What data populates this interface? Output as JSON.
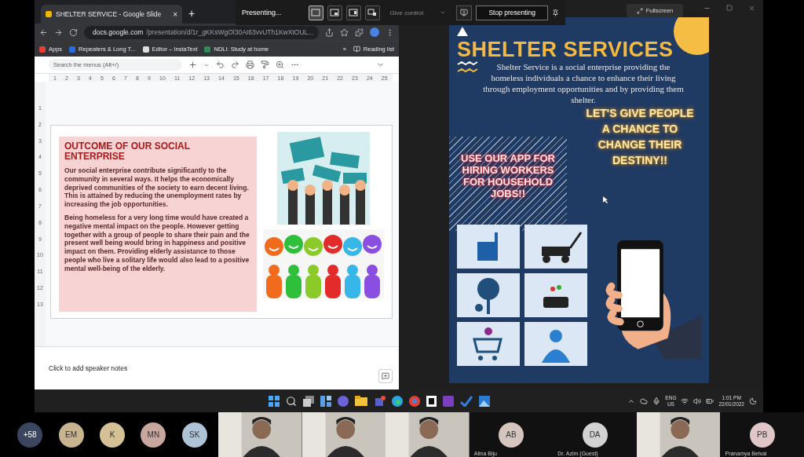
{
  "presenting_bar": {
    "status": "Presenting...",
    "layouts": [
      {
        "kind": "content",
        "selected": true
      },
      {
        "kind": "standout",
        "selected": false
      },
      {
        "kind": "side",
        "selected": false
      },
      {
        "kind": "reporter",
        "selected": false
      }
    ],
    "give_control": {
      "label": "Give control",
      "disabled": true
    },
    "stop_button": "Stop presenting"
  },
  "fullscreen_button": "Fullscreen",
  "browser": {
    "tab": {
      "title": "SHELTER SERVICE - Google Slide",
      "close": "×"
    },
    "new_tab": "+",
    "url": {
      "host": "docs.google.com",
      "path": "/presentation/d/1r_gKKsWgOl30AI63vvUTh1KwXtOUL..."
    },
    "bookmarks": [
      "Apps",
      "Repeaters & Long T...",
      "Editor – InstaText",
      "NDLI: Study at home"
    ],
    "more": "»",
    "reading_list": "Reading list"
  },
  "slides_app": {
    "search": {
      "placeholder": "Search the menus (Alt+/)"
    },
    "ruler": [
      "1",
      "2",
      "3",
      "4",
      "5",
      "6",
      "7",
      "8",
      "9",
      "10",
      "11",
      "12",
      "13",
      "14",
      "15",
      "16",
      "17",
      "18",
      "19",
      "20",
      "21",
      "22",
      "23",
      "24",
      "25"
    ],
    "vertical_ruler": [
      "1",
      "2",
      "3",
      "4",
      "5",
      "6",
      "7",
      "8",
      "9",
      "10",
      "11",
      "12",
      "13"
    ],
    "slide": {
      "title": "OUTCOME OF OUR SOCIAL ENTERPRISE",
      "paragraphs": [
        "Our social enterprise contribute significantly to the community in several ways. It helps the economically deprived communities of the society to earn decent living. This is attained by reducing the unemployment rates by increasing the job opportunities.",
        "Being homeless for a very long time would have created a negative mental impact on the people. However getting together with a group of people to share their pain and the present well being would bring in happiness and positive impact on them. Providing elderly assistance to those  people who live a solitary life would also lead to a positive mental well-being of the elderly."
      ]
    },
    "speaker_notes": {
      "placeholder": "Click to add speaker notes"
    }
  },
  "poster": {
    "title": "SHELTER SERVICES",
    "intro": "Shelter Service is a social enterprise providing the homeless individuals a chance to enhance their living through employment opportunities and by providing them shelter.",
    "slogan": "LET'S GIVE PEOPLE A CHANCE TO CHANGE THEIR DESTINY!!",
    "app_call": "USE OUR APP FOR HIRING WORKERS FOR HOUSEHOLD JOBS!!"
  },
  "taskbar": {
    "language": "ENG",
    "region": "US",
    "time": "1:01 PM",
    "date": "22/01/2022"
  },
  "participants": [
    {
      "kind": "bubble",
      "initials": "+58",
      "color": "#3a4560"
    },
    {
      "kind": "bubble",
      "initials": "EM",
      "color": "#c8b48e"
    },
    {
      "kind": "bubble",
      "initials": "K",
      "color": "#d4c196"
    },
    {
      "kind": "bubble",
      "initials": "MN",
      "color": "#c7a79d"
    },
    {
      "kind": "bubble",
      "initials": "SK",
      "color": "#aec3d6"
    },
    {
      "kind": "video"
    },
    {
      "kind": "video"
    },
    {
      "kind": "video"
    },
    {
      "kind": "tile",
      "initials": "AB",
      "name": "Alina Biju",
      "color": "#d6c5bf"
    },
    {
      "kind": "tile",
      "initials": "DA",
      "name": "Dr. Azim (Guest)",
      "color": "#d2d2d2"
    },
    {
      "kind": "video"
    },
    {
      "kind": "tile",
      "initials": "PB",
      "name": "Pranamya Belvai",
      "color": "#e0c7c7"
    }
  ]
}
